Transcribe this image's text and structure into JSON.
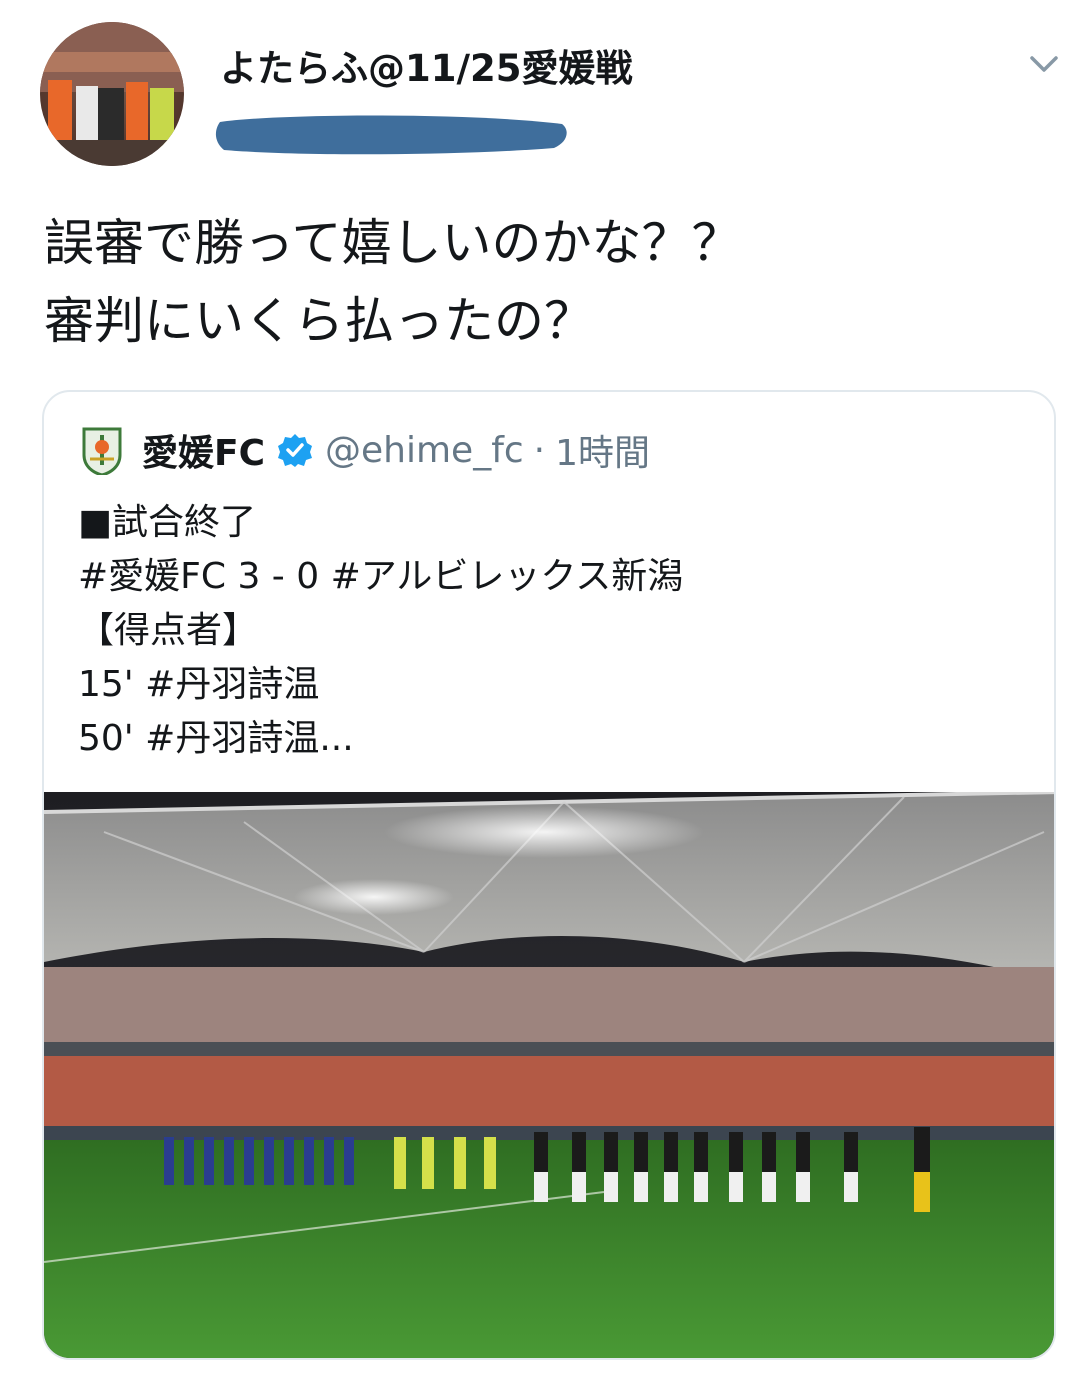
{
  "tweet": {
    "display_name": "よたらふ@11/25愛媛戦",
    "text": "誤審で勝って嬉しいのかな？？\n審判にいくら払ったの？"
  },
  "quoted_tweet": {
    "name": "愛媛FC",
    "handle": "@ehime_fc",
    "separator": "·",
    "time": "1時間",
    "text": "■試合終了\n#愛媛FC 3 - 0 #アルビレックス新潟\n【得点者】\n15' #丹羽詩温\n50' #丹羽詩温..."
  },
  "icons": {
    "menu": "chevron-down-icon",
    "verified": "verified-badge-icon",
    "logo": "club-crest-icon"
  },
  "colors": {
    "text": "#14171a",
    "secondary": "#657786",
    "verified": "#1da1f2",
    "border": "#e1e8ed",
    "redaction": "#3f6e9c",
    "pitch": "#3f8a2e"
  }
}
